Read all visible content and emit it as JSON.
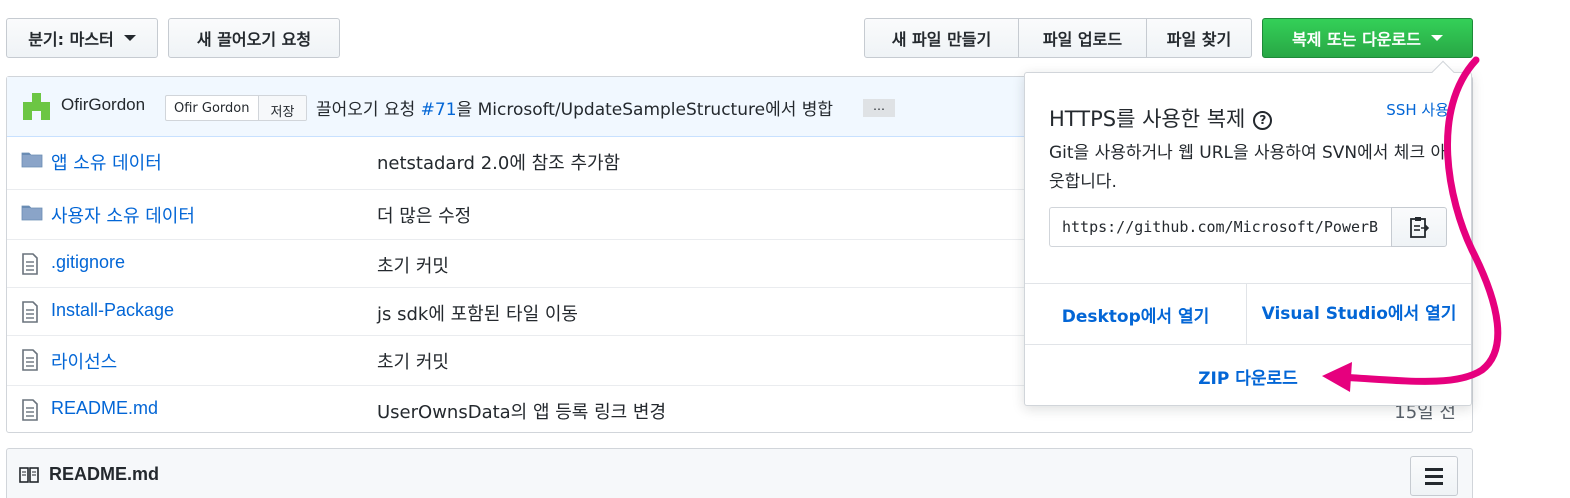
{
  "toolbar": {
    "branch_label": "분기: 마스터",
    "new_pr_label": "새 끌어오기 요청",
    "create_file_label": "새 파일 만들기",
    "upload_label": "파일 업로드",
    "find_file_label": "파일 찾기",
    "clone_label": "복제 또는 다운로드"
  },
  "commit": {
    "author": "OfirGordon",
    "badge_name": "Ofir Gordon",
    "badge_action": "저장",
    "message_prefix": "끌어오기 요청 ",
    "pr_number": "#71",
    "message_suffix": "을 Microsoft/UpdateSampleStructure에서 병합",
    "ellipsis": "…"
  },
  "files": [
    {
      "type": "folder",
      "icon": "folder-icon",
      "name": "앱 소유 데이터",
      "message": "netstadard 2.0에 참조 추가함",
      "age": ""
    },
    {
      "type": "folder",
      "icon": "folder-icon",
      "name": "사용자 소유 데이터",
      "message": "더 많은 수정",
      "age": ""
    },
    {
      "type": "file",
      "icon": "file-icon",
      "name": ".gitignore",
      "message": "초기 커밋",
      "age": ""
    },
    {
      "type": "file",
      "icon": "file-icon",
      "name": "Install-Package",
      "message": "js sdk에 포함된 타일 이동",
      "age": ""
    },
    {
      "type": "file",
      "icon": "file-icon",
      "name": "라이선스",
      "message": "초기 커밋",
      "age": ""
    },
    {
      "type": "file",
      "icon": "file-icon",
      "name": "README.md",
      "message": "UserOwnsData의 앱 등록 링크 변경",
      "age": "15일 전"
    }
  ],
  "readme": {
    "title": "README.md"
  },
  "clone_dropdown": {
    "title": "HTTPS를 사용한 복제",
    "help_glyph": "?",
    "ssh_link": "SSH 사용",
    "description": "Git을 사용하거나 웹 URL을 사용하여 SVN에서 체크 아웃합니다.",
    "url": "https://github.com/Microsoft/PowerBI-Developer-Samples.git",
    "open_desktop": "Desktop에서 열기",
    "open_vs": "Visual Studio에서 열기",
    "download_zip": "ZIP 다운로드"
  },
  "colors": {
    "accent_blue": "#0366d6",
    "green_button": "#2cbe4e",
    "annotation_arrow": "#e6007e"
  }
}
